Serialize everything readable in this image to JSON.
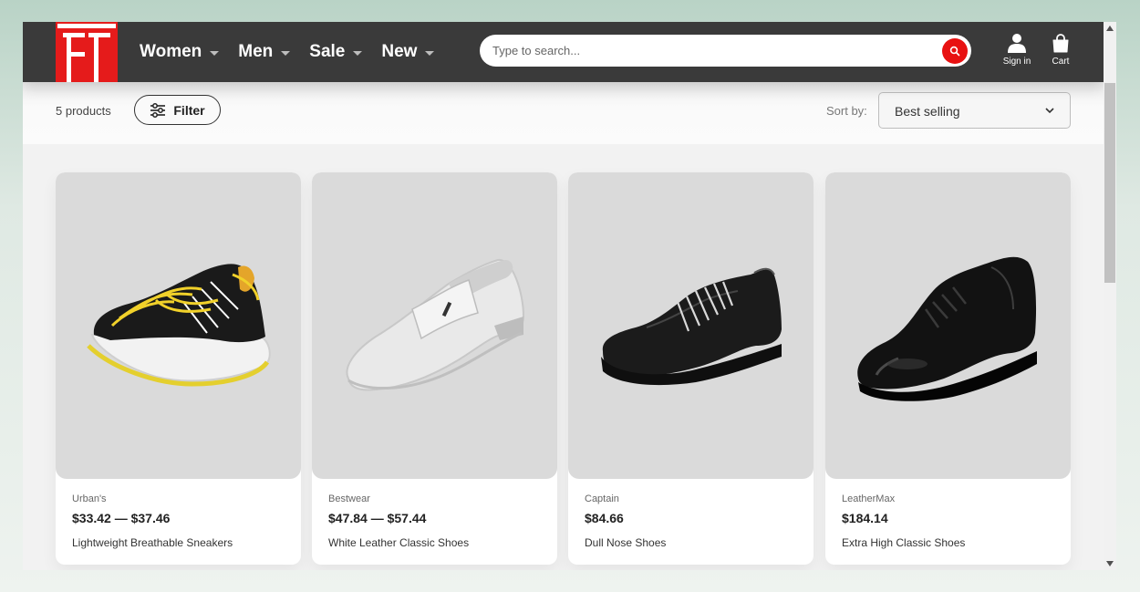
{
  "header": {
    "nav": [
      {
        "label": "Women"
      },
      {
        "label": "Men"
      },
      {
        "label": "Sale"
      },
      {
        "label": "New"
      }
    ],
    "search": {
      "placeholder": "Type to search..."
    },
    "sign_in_label": "Sign in",
    "cart_label": "Cart"
  },
  "toolbar": {
    "product_count": "5 products",
    "filter_label": "Filter",
    "sort_label": "Sort by:",
    "sort_value": "Best selling"
  },
  "products": [
    {
      "brand": "Urban's",
      "price": "$33.42 — $37.46",
      "title": "Lightweight Breathable Sneakers",
      "image": "sneaker-black-yellow"
    },
    {
      "brand": "Bestwear",
      "price": "$47.84 — $57.44",
      "title": "White Leather Classic Shoes",
      "image": "loafer-white"
    },
    {
      "brand": "Captain",
      "price": "$84.66",
      "title": "Dull Nose Shoes",
      "image": "derby-black-matte"
    },
    {
      "brand": "LeatherMax",
      "price": "$184.14",
      "title": "Extra High Classic Shoes",
      "image": "oxford-black-glossy"
    }
  ],
  "colors": {
    "header_bg": "#3a3a3a",
    "logo_red": "#e51b1b",
    "search_button": "#e81111",
    "card_image_bg": "#dadada"
  }
}
